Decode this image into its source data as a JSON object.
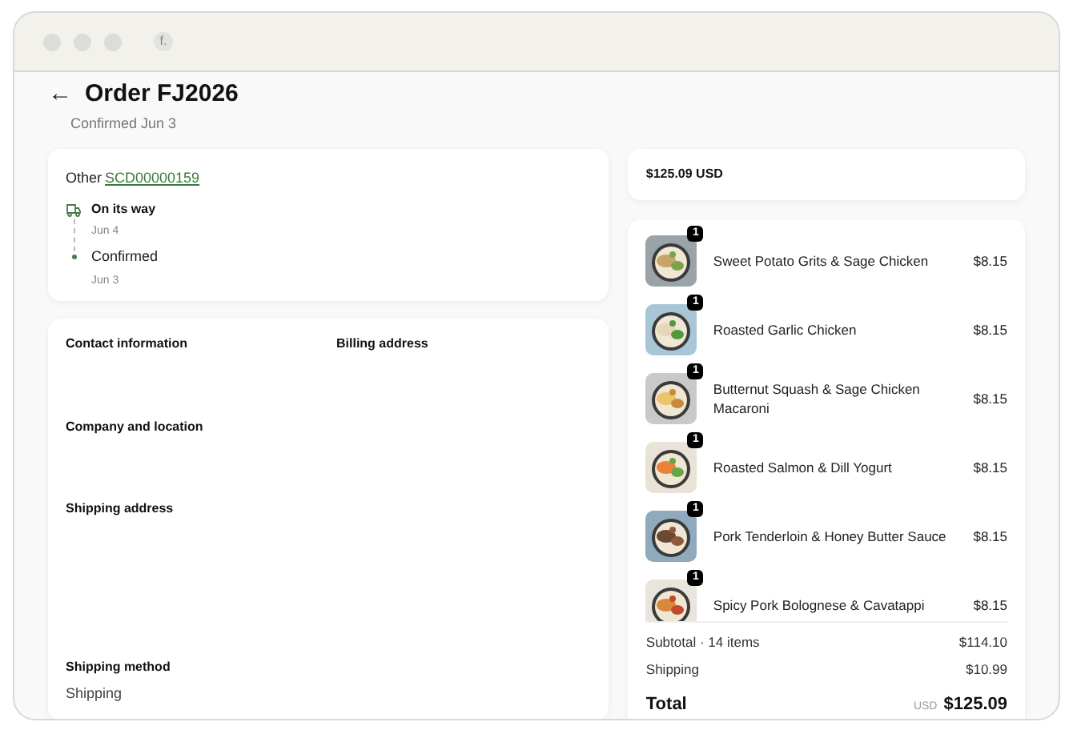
{
  "window": {
    "tab_icon": "f."
  },
  "header": {
    "back": "←",
    "title": "Order FJ2026",
    "subtitle": "Confirmed Jun 3"
  },
  "reference": {
    "label": "Other",
    "link": "SCD00000159"
  },
  "timeline": [
    {
      "kind": "truck",
      "label": "On its way",
      "date": "Jun 4"
    },
    {
      "kind": "dot",
      "label": "Confirmed",
      "date": "Jun 3"
    }
  ],
  "details": {
    "contact": "Contact information",
    "billing": "Billing address",
    "company": "Company and location",
    "shipping_address": "Shipping address",
    "shipping_method": "Shipping method",
    "shipping_method_value": "Shipping"
  },
  "total_card": {
    "amount": "$125.09 USD"
  },
  "items": [
    {
      "name": "Sweet Potato Grits & Sage Chicken",
      "price": "$8.15",
      "quantity": "1"
    },
    {
      "name": "Roasted Garlic Chicken",
      "price": "$8.15",
      "quantity": "1"
    },
    {
      "name": "Butternut Squash & Sage Chicken Macaroni",
      "price": "$8.15",
      "quantity": "1"
    },
    {
      "name": "Roasted Salmon & Dill Yogurt",
      "price": "$8.15",
      "quantity": "1"
    },
    {
      "name": "Pork Tenderloin & Honey Butter Sauce",
      "price": "$8.15",
      "quantity": "1"
    },
    {
      "name": "Spicy Pork Bolognese & Cavatappi",
      "price": "$8.15",
      "quantity": "1"
    }
  ],
  "summary": {
    "subtotal_label": "Subtotal · 14 items",
    "subtotal": "$114.10",
    "shipping_label": "Shipping",
    "shipping": "$10.99",
    "total_label": "Total",
    "currency": "USD",
    "total": "$125.09"
  }
}
